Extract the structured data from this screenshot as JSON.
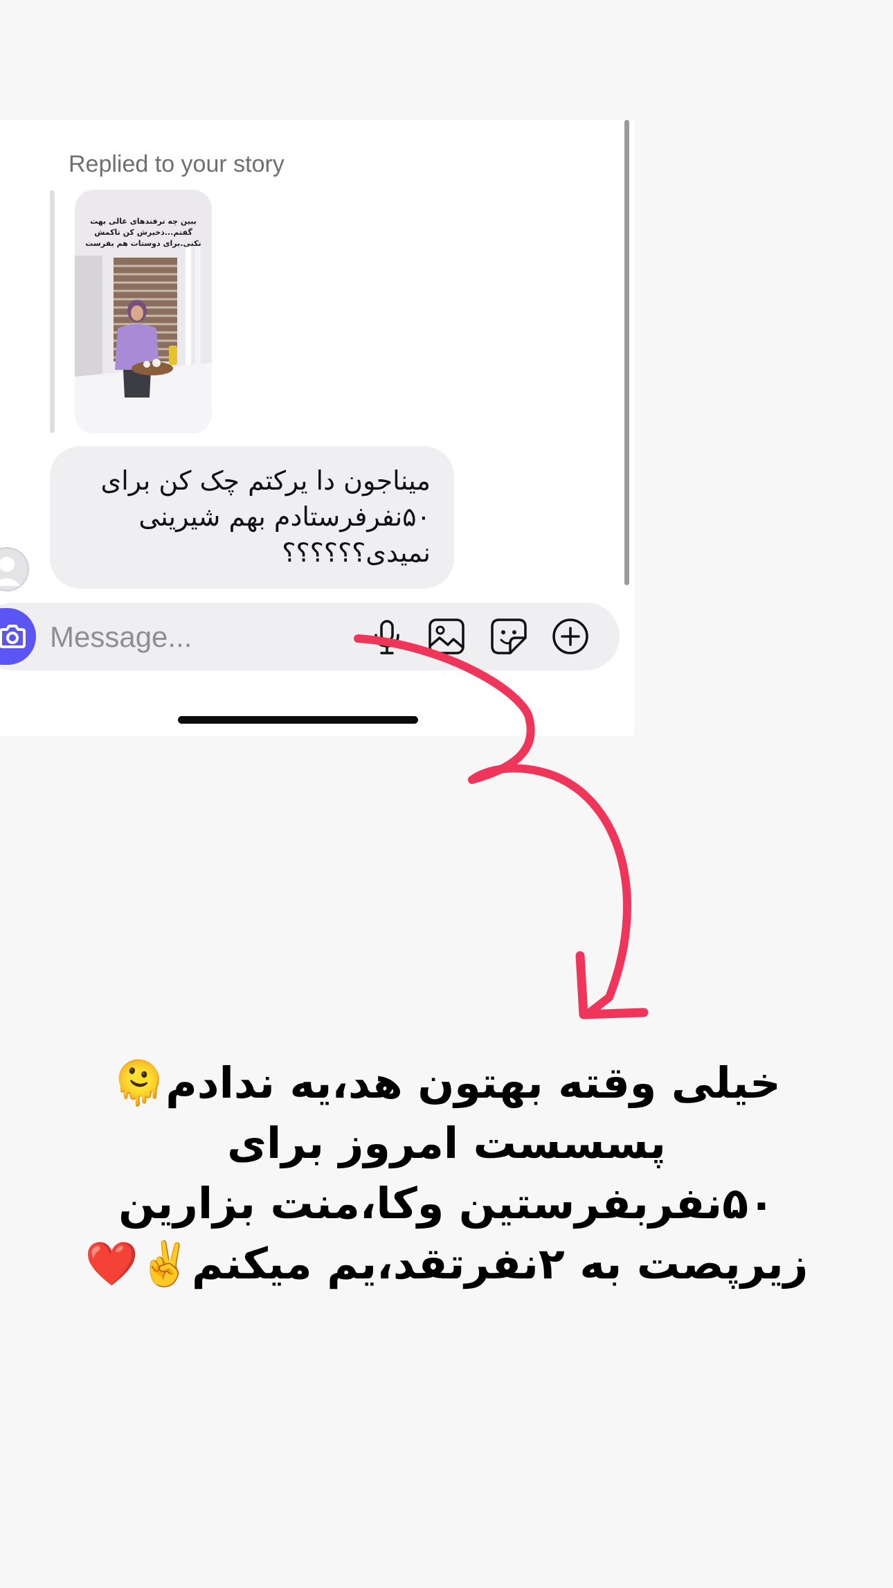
{
  "chat": {
    "reply_label": "Replied to your story",
    "story_caption": "ببین چه ترفندهای عالی بهت گفتم...ذخیرش کن تاکمش نکنی.برای دوستات هم بفرست",
    "message_text": "میناجون دا یرکتم چک کن برای ۵۰نفرفرستادم بهم شیرینی نمیدی؟؟؟؟؟؟"
  },
  "composer": {
    "placeholder": "Message...",
    "icons": [
      "camera-icon",
      "microphone-icon",
      "image-icon",
      "sticker-icon",
      "plus-circle-icon"
    ]
  },
  "colors": {
    "accent": "#5b55f3",
    "arrow": "#f0355a",
    "bubble": "#efeff1",
    "page": "#f7f7f8"
  },
  "annotation": {
    "lines": [
      "خیلی وقته بهتون هد،یه ندادم🫠",
      "پسسست امروز برای",
      "۵۰نفربفرستین وکا،منت بزارین",
      "زیرپصت به ۲نفرتقد،یم میکنم✌️❤️"
    ]
  }
}
